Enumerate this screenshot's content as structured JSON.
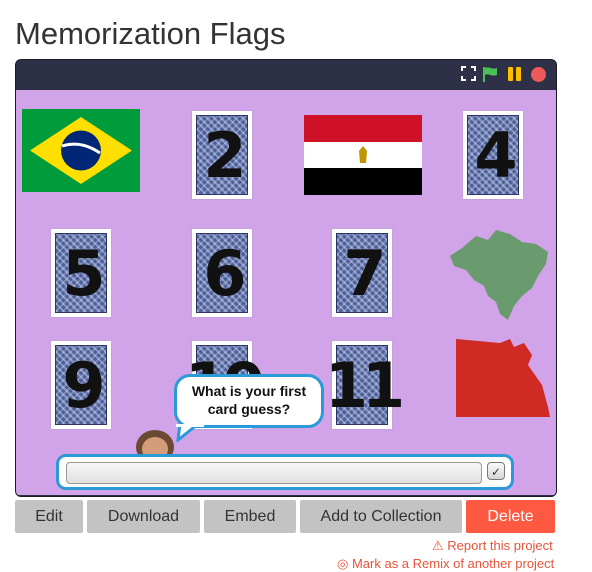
{
  "page": {
    "title": "Memorization Flags"
  },
  "player": {
    "topbar_icons": [
      "fullscreen-icon",
      "green-flag-icon",
      "pause-icon",
      "stop-icon"
    ],
    "colors": {
      "topbar": "#2d3046",
      "stage_bg": "#d1a3e8",
      "accent": "#2c9ad8"
    },
    "cards": [
      "2",
      "4",
      "5",
      "6",
      "7",
      "9",
      "10",
      "11"
    ],
    "flags": [
      "brazil-flag",
      "egypt-flag"
    ],
    "maps": [
      "brazil-map",
      "egypt-map"
    ],
    "speech_bubble": "What is your first card guess?",
    "answer": {
      "value": "",
      "submit_icon": "checkmark-icon"
    }
  },
  "actions": {
    "edit": "Edit",
    "download": "Download",
    "embed": "Embed",
    "add_to_collection": "Add to Collection",
    "delete": "Delete",
    "report": "Report this project",
    "remix": "Mark as a Remix of another project"
  }
}
